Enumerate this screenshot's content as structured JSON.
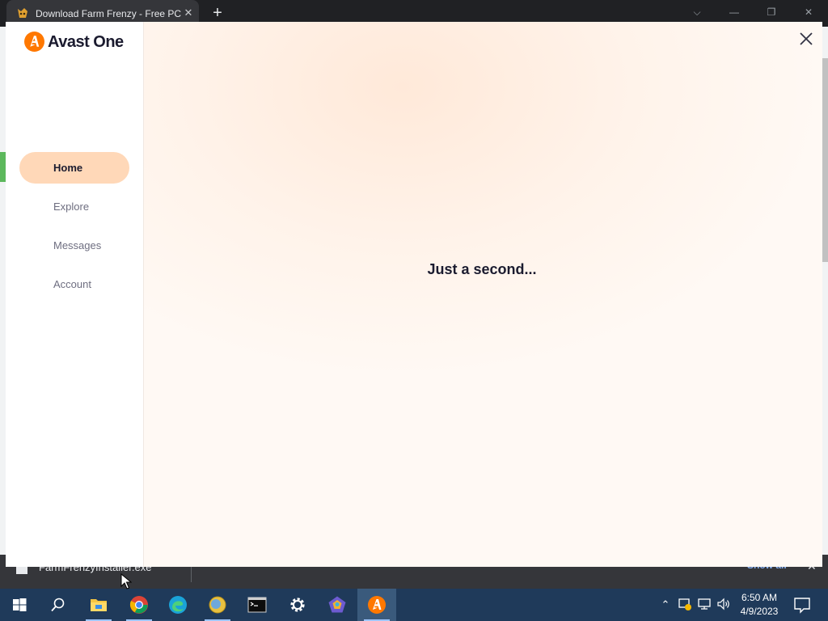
{
  "browser": {
    "tab_title": "Download Farm Frenzy - Free PC",
    "tab_close": "✕",
    "new_tab": "+",
    "window_controls": {
      "dropdown": "⌵",
      "minimize": "—",
      "restore": "❐",
      "close": "✕"
    }
  },
  "download_bar": {
    "filename": "FarmFrenzyInstaller.exe",
    "show_all": "Show all"
  },
  "avast": {
    "logo_text": "Avast One",
    "brand_color": "#ff7800",
    "nav": [
      {
        "label": "Home",
        "active": true
      },
      {
        "label": "Explore",
        "active": false
      },
      {
        "label": "Messages",
        "active": false
      },
      {
        "label": "Account",
        "active": false
      }
    ],
    "loading_text": "Just a second..."
  },
  "taskbar": {
    "items": [
      "start-button",
      "search-button",
      "file-explorer",
      "chrome",
      "edge",
      "app-yellow",
      "terminal",
      "settings",
      "app-pentagon",
      "avast-one"
    ],
    "clock_time": "6:50 AM",
    "clock_date": "4/9/2023"
  }
}
